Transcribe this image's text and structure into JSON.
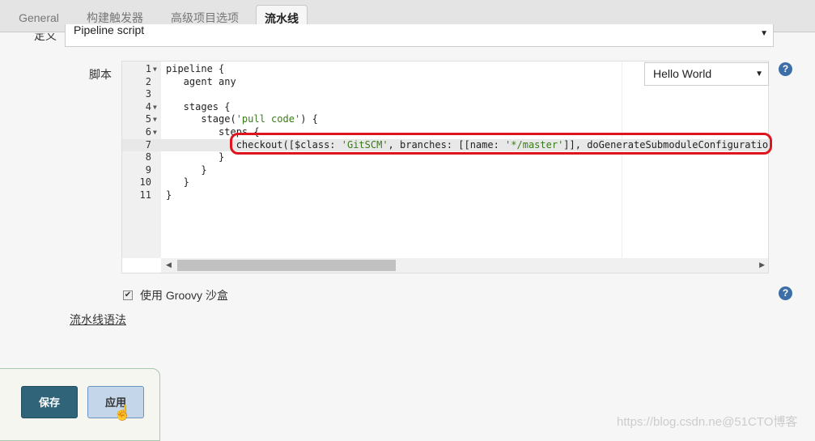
{
  "tabs": [
    {
      "label": "General"
    },
    {
      "label": "构建触发器"
    },
    {
      "label": "高级项目选项"
    },
    {
      "label": "流水线",
      "active": true
    }
  ],
  "definition": {
    "label": "定义",
    "value": "Pipeline script"
  },
  "script": {
    "label": "脚本",
    "sample_select": "Hello World",
    "lines": [
      {
        "n": "1",
        "fold": true,
        "code": "pipeline {"
      },
      {
        "n": "2",
        "code": "   agent any"
      },
      {
        "n": "3",
        "code": ""
      },
      {
        "n": "4",
        "fold": true,
        "code": "   stages {"
      },
      {
        "n": "5",
        "fold": true,
        "code": "      stage('pull code') {"
      },
      {
        "n": "6",
        "fold": true,
        "code": "         steps {"
      },
      {
        "n": "7",
        "code": "            checkout([$class: 'GitSCM', branches: [[name: '*/master']], doGenerateSubmoduleConfigurations",
        "highlight": true
      },
      {
        "n": "8",
        "code": "         }"
      },
      {
        "n": "9",
        "code": "      }"
      },
      {
        "n": "10",
        "code": "   }"
      },
      {
        "n": "11",
        "code": "}"
      }
    ]
  },
  "sandbox": {
    "label": "使用 Groovy 沙盒",
    "checked": true
  },
  "syntax_link": "流水线语法",
  "buttons": {
    "save": "保存",
    "apply": "应用"
  },
  "watermark": "https://blog.csdn.ne@51CTO博客",
  "colors": {
    "save": "#2f6479",
    "apply": "#c4d6ea",
    "highlight_box": "#e0141e",
    "help": "#3c6ea8"
  }
}
